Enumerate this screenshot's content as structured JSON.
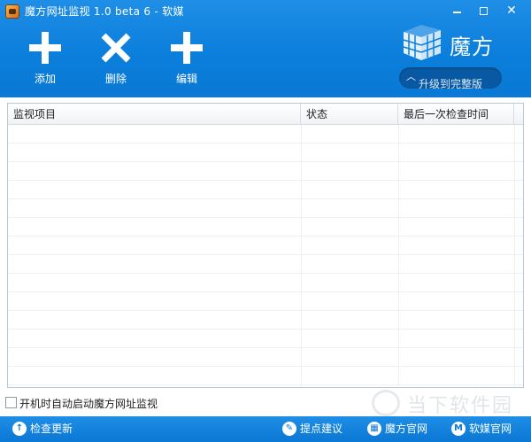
{
  "window": {
    "title": "魔方网址监视 1.0 beta 6 - 软媒",
    "minimize_glyph": "",
    "close_glyph": "✕"
  },
  "toolbar": {
    "add_label": "添加",
    "delete_label": "删除",
    "edit_label": "编辑"
  },
  "brand": {
    "name": "魔方",
    "upgrade_label": "升级到完整版",
    "upgrade_icon": "chevron-up-icon"
  },
  "table": {
    "columns": [
      "监视项目",
      "状态",
      "最后一次检查时间"
    ],
    "rows": []
  },
  "options": {
    "autostart_label": "开机时自动启动魔方网址监视",
    "autostart_checked": false
  },
  "statusbar": {
    "check_update": "检查更新",
    "suggest": "提点建议",
    "official_site": "魔方官网",
    "ruanmei_site": "软媒官网"
  },
  "watermark": {
    "text": "当下软件园"
  },
  "colors": {
    "accent": "#0b7fdc",
    "header_bg": "#f0f3f6",
    "grid_line": "#eef1f4"
  }
}
